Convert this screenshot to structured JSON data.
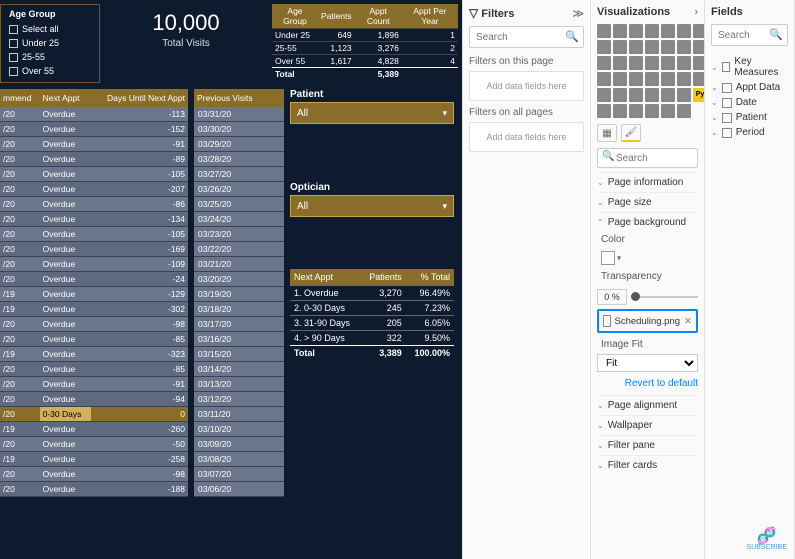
{
  "slicer": {
    "title": "Age Group",
    "items": [
      "Select all",
      "Under 25",
      "25-55",
      "Over 55"
    ]
  },
  "kpi": {
    "value": "10,000",
    "label": "Total Visits"
  },
  "ageTable": {
    "headers": [
      "Age Group",
      "Patients",
      "Appt Count",
      "Appt Per Year"
    ],
    "rows": [
      [
        "Under 25",
        "649",
        "1,896",
        "1"
      ],
      [
        "25-55",
        "1,123",
        "3,276",
        "2"
      ],
      [
        "Over 55",
        "1,617",
        "4,828",
        "4"
      ]
    ],
    "total": [
      "Total",
      "",
      "5,389",
      ""
    ]
  },
  "apptTable": {
    "headers": [
      "mmend",
      "Next Appt",
      "Days Until Next Appt"
    ],
    "rows": [
      [
        "/20",
        "Overdue",
        "-113"
      ],
      [
        "/20",
        "Overdue",
        "-152"
      ],
      [
        "/20",
        "Overdue",
        "-91"
      ],
      [
        "/20",
        "Overdue",
        "-89"
      ],
      [
        "/20",
        "Overdue",
        "-105"
      ],
      [
        "/20",
        "Overdue",
        "-207"
      ],
      [
        "/20",
        "Overdue",
        "-86"
      ],
      [
        "/20",
        "Overdue",
        "-134"
      ],
      [
        "/20",
        "Overdue",
        "-105"
      ],
      [
        "/20",
        "Overdue",
        "-169"
      ],
      [
        "/20",
        "Overdue",
        "-109"
      ],
      [
        "/20",
        "Overdue",
        "-24"
      ],
      [
        "/19",
        "Overdue",
        "-129"
      ],
      [
        "/19",
        "Overdue",
        "-302"
      ],
      [
        "/20",
        "Overdue",
        "-98"
      ],
      [
        "/20",
        "Overdue",
        "-85"
      ],
      [
        "/19",
        "Overdue",
        "-323"
      ],
      [
        "/20",
        "Overdue",
        "-85"
      ],
      [
        "/20",
        "Overdue",
        "-91"
      ],
      [
        "/20",
        "Overdue",
        "-94"
      ],
      [
        "/20",
        "0-30 Days",
        "0"
      ],
      [
        "/19",
        "Overdue",
        "-260"
      ],
      [
        "/20",
        "Overdue",
        "-50"
      ],
      [
        "/19",
        "Overdue",
        "-258"
      ],
      [
        "/20",
        "Overdue",
        "-98"
      ],
      [
        "/20",
        "Overdue",
        "-188"
      ]
    ],
    "hlIndex": 20
  },
  "hist": {
    "header": "Previous Visits",
    "rows": [
      "03/31/20",
      "03/30/20",
      "03/29/20",
      "03/28/20",
      "03/27/20",
      "03/26/20",
      "03/25/20",
      "03/24/20",
      "03/23/20",
      "03/22/20",
      "03/21/20",
      "03/20/20",
      "03/19/20",
      "03/18/20",
      "03/17/20",
      "03/16/20",
      "03/15/20",
      "03/14/20",
      "03/13/20",
      "03/12/20",
      "03/11/20",
      "03/10/20",
      "03/09/20",
      "03/08/20",
      "03/07/20",
      "03/06/20"
    ]
  },
  "dd1": {
    "label": "Patient",
    "value": "All"
  },
  "dd2": {
    "label": "Optician",
    "value": "All"
  },
  "sumTable": {
    "headers": [
      "Next Appt",
      "Patients",
      "% Total"
    ],
    "rows": [
      [
        "1. Overdue",
        "3,270",
        "96.49%"
      ],
      [
        "2. 0-30 Days",
        "245",
        "7.23%"
      ],
      [
        "3. 31-90 Days",
        "205",
        "6.05%"
      ],
      [
        "4. > 90 Days",
        "322",
        "9.50%"
      ]
    ],
    "total": [
      "Total",
      "3,389",
      "100.00%"
    ]
  },
  "filters": {
    "title": "Filters",
    "search_ph": "Search",
    "sub1": "Filters on this page",
    "dz1": "Add data fields here",
    "sub2": "Filters on all pages",
    "dz2": "Add data fields here"
  },
  "viz": {
    "title": "Visualizations",
    "search_ph": "Search",
    "sections": {
      "info": "Page information",
      "size": "Page size",
      "bg": "Page background",
      "align": "Page alignment",
      "wall": "Wallpaper",
      "fpane": "Filter pane",
      "fcards": "Filter cards"
    },
    "color_lbl": "Color",
    "transp_lbl": "Transparency",
    "transp_val": "0",
    "pct": "%",
    "img_name": "Scheduling.png",
    "fit_lbl": "Image Fit",
    "fit_val": "Fit",
    "revert": "Revert to default"
  },
  "fields": {
    "title": "Fields",
    "search_ph": "Search",
    "tables": [
      "Key Measures",
      "Appt Data",
      "Date",
      "Patient",
      "Period"
    ]
  },
  "watermark": "SUBSCRIBE"
}
